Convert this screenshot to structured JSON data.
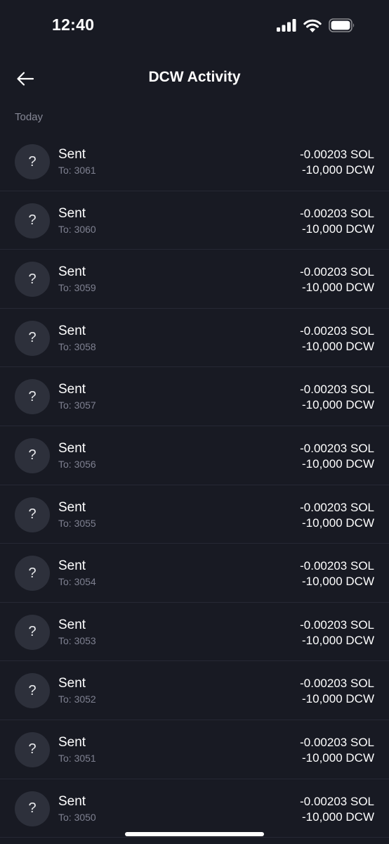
{
  "status_bar": {
    "time": "12:40",
    "icons": [
      "signal-icon",
      "wifi-icon",
      "battery-icon"
    ]
  },
  "header": {
    "back_icon": "arrow-left-icon",
    "title": "DCW Activity"
  },
  "section": {
    "label": "Today"
  },
  "colors": {
    "background": "#181a23",
    "avatar": "#2d303b",
    "muted_text": "#7e8090",
    "divider": "#262834"
  },
  "activities": [
    {
      "avatar": "?",
      "title": "Sent",
      "subtitle": "To: 3061",
      "sol": "-0.00203 SOL",
      "dcw": "-10,000 DCW"
    },
    {
      "avatar": "?",
      "title": "Sent",
      "subtitle": "To: 3060",
      "sol": "-0.00203 SOL",
      "dcw": "-10,000 DCW"
    },
    {
      "avatar": "?",
      "title": "Sent",
      "subtitle": "To: 3059",
      "sol": "-0.00203 SOL",
      "dcw": "-10,000 DCW"
    },
    {
      "avatar": "?",
      "title": "Sent",
      "subtitle": "To: 3058",
      "sol": "-0.00203 SOL",
      "dcw": "-10,000 DCW"
    },
    {
      "avatar": "?",
      "title": "Sent",
      "subtitle": "To: 3057",
      "sol": "-0.00203 SOL",
      "dcw": "-10,000 DCW"
    },
    {
      "avatar": "?",
      "title": "Sent",
      "subtitle": "To: 3056",
      "sol": "-0.00203 SOL",
      "dcw": "-10,000 DCW"
    },
    {
      "avatar": "?",
      "title": "Sent",
      "subtitle": "To: 3055",
      "sol": "-0.00203 SOL",
      "dcw": "-10,000 DCW"
    },
    {
      "avatar": "?",
      "title": "Sent",
      "subtitle": "To: 3054",
      "sol": "-0.00203 SOL",
      "dcw": "-10,000 DCW"
    },
    {
      "avatar": "?",
      "title": "Sent",
      "subtitle": "To: 3053",
      "sol": "-0.00203 SOL",
      "dcw": "-10,000 DCW"
    },
    {
      "avatar": "?",
      "title": "Sent",
      "subtitle": "To: 3052",
      "sol": "-0.00203 SOL",
      "dcw": "-10,000 DCW"
    },
    {
      "avatar": "?",
      "title": "Sent",
      "subtitle": "To: 3051",
      "sol": "-0.00203 SOL",
      "dcw": "-10,000 DCW"
    },
    {
      "avatar": "?",
      "title": "Sent",
      "subtitle": "To: 3050",
      "sol": "-0.00203 SOL",
      "dcw": "-10,000 DCW"
    }
  ]
}
